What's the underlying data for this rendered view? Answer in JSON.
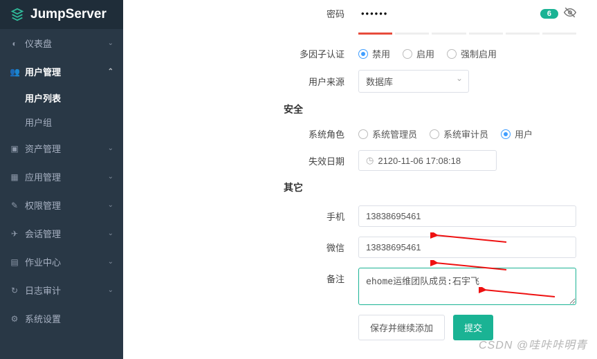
{
  "brand": "JumpServer",
  "sidebar": {
    "items": [
      {
        "icon": "◐",
        "label": "仪表盘",
        "chev": "⌄"
      },
      {
        "icon": "👥",
        "label": "用户管理",
        "chev": "⌃",
        "active": true,
        "subs": [
          {
            "label": "用户列表",
            "active": true
          },
          {
            "label": "用户组"
          }
        ]
      },
      {
        "icon": "▣",
        "label": "资产管理",
        "chev": "⌄"
      },
      {
        "icon": "▦",
        "label": "应用管理",
        "chev": "⌄"
      },
      {
        "icon": "✎",
        "label": "权限管理",
        "chev": "⌄"
      },
      {
        "icon": "✈",
        "label": "会话管理",
        "chev": "⌄"
      },
      {
        "icon": "▤",
        "label": "作业中心",
        "chev": "⌄"
      },
      {
        "icon": "↻",
        "label": "日志审计",
        "chev": "⌄"
      },
      {
        "icon": "⚙",
        "label": "系统设置"
      }
    ]
  },
  "form": {
    "password_label": "密码",
    "password_value": "••••••",
    "password_score": "6",
    "mfa_label": "多因子认证",
    "mfa_options": [
      "禁用",
      "启用",
      "强制启用"
    ],
    "mfa_selected": 0,
    "source_label": "用户来源",
    "source_value": "数据库",
    "section_security": "安全",
    "role_label": "系统角色",
    "role_options": [
      "系统管理员",
      "系统审计员",
      "用户"
    ],
    "role_selected": 2,
    "expire_label": "失效日期",
    "expire_value": "2120-11-06 17:08:18",
    "section_other": "其它",
    "phone_label": "手机",
    "phone_value": "13838695461",
    "wechat_label": "微信",
    "wechat_value": "13838695461",
    "remark_label": "备注",
    "remark_value": "ehome运维团队成员:石宇飞",
    "btn_save_continue": "保存并继续添加",
    "btn_submit": "提交"
  },
  "watermark": "CSDN @哇咔咔明青"
}
